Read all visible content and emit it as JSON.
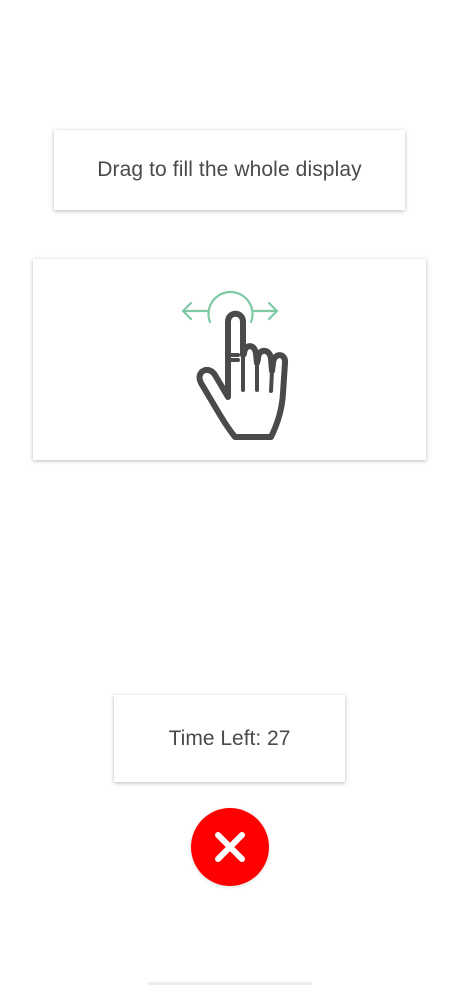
{
  "instruction": {
    "text": "Drag to fill the whole display"
  },
  "illustration": {
    "icon": "hand-swipe-icon",
    "arrow_color": "#7fc9a5",
    "hand_color": "#4a4a4a"
  },
  "timer": {
    "label": "Time Left: 27"
  },
  "close_button": {
    "icon": "close-icon",
    "color": "#ff0000"
  }
}
